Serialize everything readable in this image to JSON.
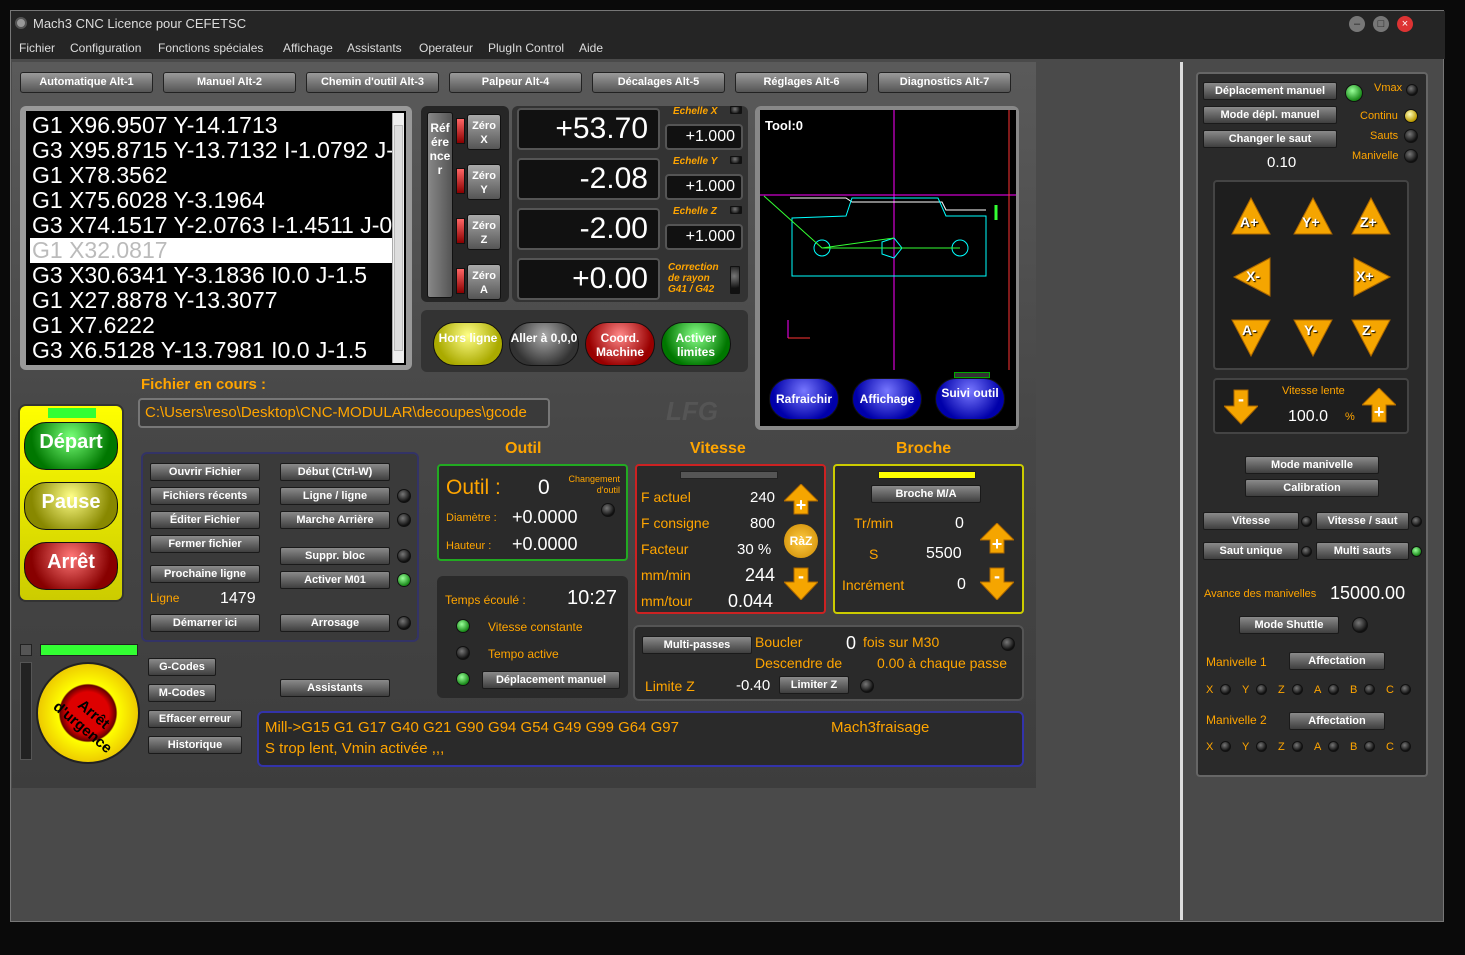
{
  "window": {
    "title": "Mach3 CNC  Licence pour CEFETSC"
  },
  "menu": [
    "Fichier",
    "Configuration",
    "Fonctions spéciales",
    "Affichage",
    "Assistants",
    "Operateur",
    "PlugIn Control",
    "Aide"
  ],
  "tabs": [
    "Automatique Alt-1",
    "Manuel Alt-2",
    "Chemin d'outil Alt-3",
    "Palpeur Alt-4",
    "Décalages Alt-5",
    "Réglages Alt-6",
    "Diagnostics Alt-7"
  ],
  "gcode": {
    "lines": [
      "G1 X96.9507 Y-14.1713",
      "G3 X95.8715 Y-13.7132 I-1.0792 J-",
      "G1 X78.3562",
      "G1 X75.6028 Y-3.1964",
      "G3 X74.1517 Y-2.0763 I-1.4511 J-0",
      "G1 X32.0817",
      "G3 X30.6341 Y-3.1836 I0.0 J-1.5",
      "G1 X27.8878 Y-13.3077",
      "G1 X7.6222",
      "G3 X6.5128 Y-13.7981 I0.0 J-1.5"
    ],
    "current_index": 5
  },
  "referencer": "Référencer",
  "zero_buttons": [
    "Zéro X",
    "Zéro Y",
    "Zéro Z",
    "Zéro A"
  ],
  "dro": {
    "x": "+53.70",
    "y": "-2.08",
    "z": "-2.00",
    "a": "+0.00"
  },
  "scales": {
    "x_label": "Echelle X",
    "y_label": "Echelle Y",
    "z_label": "Echelle Z",
    "x": "+1.000",
    "y": "+1.000",
    "z": "+1.000",
    "radius_label": "Correction de rayon G41 / G42"
  },
  "pills": {
    "offline": "Hors ligne",
    "goto": "Aller à 0,0,0",
    "machine": "Coord. Machine",
    "limits": "Activer limites"
  },
  "toolpath": {
    "label": "Tool:0",
    "refresh": "Rafraichir",
    "display": "Affichage",
    "follow": "Suivi outil"
  },
  "file": {
    "label": "Fichier en cours :",
    "path": "C:\\Users\\reso\\Desktop\\CNC-MODULAR\\decoupes\\gcode"
  },
  "cycle": {
    "start": "Départ",
    "pause": "Pause",
    "stop": "Arrêt",
    "estop": "Arrêt d'urgence"
  },
  "file_buttons": {
    "open": "Ouvrir Fichier",
    "recent": "Fichiers récents",
    "edit": "Éditer Fichier",
    "close": "Fermer fichier",
    "next_line": "Prochaine ligne",
    "line_label": "Ligne",
    "line_value": "1479",
    "start_here": "Démarrer ici",
    "begin": "Début (Ctrl-W)",
    "line_by_line": "Ligne / ligne",
    "reverse": "Marche Arrière",
    "block_delete": "Suppr. bloc",
    "m01": "Activer M01",
    "coolant": "Arrosage"
  },
  "left_buttons": {
    "gcodes": "G-Codes",
    "mcodes": "M-Codes",
    "reset": "Effacer erreur",
    "history": "Historique",
    "wizards": "Assistants"
  },
  "tool": {
    "title": "Outil",
    "label": "Outil :",
    "value": "0",
    "change": "Changement d'outil",
    "diam_label": "Diamètre :",
    "diam": "+0.0000",
    "height_label": "Hauteur :",
    "height": "+0.0000"
  },
  "time": {
    "label": "Temps écoulé :",
    "value": "10:27",
    "cv": "Vitesse constante",
    "dwell": "Tempo active",
    "jog": "Déplacement manuel"
  },
  "feed": {
    "title": "Vitesse",
    "actual_label": "F actuel",
    "actual": "240",
    "set_label": "F consigne",
    "set": "800",
    "factor_label": "Facteur",
    "factor": "30 %",
    "mmmin_label": "mm/min",
    "mmmin": "244",
    "mmrev_label": "mm/tour",
    "mmrev": "0.044",
    "raz": "RàZ"
  },
  "spindle": {
    "title": "Broche",
    "toggle": "Broche M/A",
    "rpm_label": "Tr/min",
    "rpm": "0",
    "s_label": "S",
    "s": "5500",
    "inc_label": "Incrément",
    "inc": "0"
  },
  "multipass": {
    "button": "Multi-passes",
    "loop_label": "Boucler",
    "loop_val": "0",
    "loop_suffix": "fois sur M30",
    "down_label": "Descendre de",
    "down_val": "0.00 à chaque passe",
    "limitz_label": "Limite Z",
    "limitz_val": "-0.40",
    "limitz_btn": "Limiter Z"
  },
  "status": {
    "modal": "Mill->G15  G1 G17 G40 G21 G90 G94 G54 G49 G99 G64 G97",
    "profile": "Mach3fraisage",
    "message": "S trop lent, Vmin activée ,,,"
  },
  "jog": {
    "manual": "Déplacement manuel",
    "mode": "Mode dépl. manuel",
    "step": "Changer le saut",
    "step_value": "0.10",
    "vmax": "Vmax",
    "continu": "Continu",
    "sauts": "Sauts",
    "manivelle": "Manivelle",
    "arrows": [
      "A+",
      "Y+",
      "Z+",
      "X-",
      "X+",
      "A-",
      "Y-",
      "Z-"
    ],
    "slow_label": "Vitesse lente",
    "slow_value": "100.0",
    "pct": "%",
    "mpg_mode": "Mode manivelle",
    "calibration": "Calibration",
    "speed": "Vitesse",
    "speed_step": "Vitesse / saut",
    "single": "Saut unique",
    "multi": "Multi sauts",
    "mpg_feed_label": "Avance des manivelles",
    "mpg_feed": "15000.00",
    "shuttle": "Mode Shuttle",
    "mpg1": "Manivelle 1",
    "mpg2": "Manivelle 2",
    "assign": "Affectation",
    "axes": [
      "X",
      "Y",
      "Z",
      "A",
      "B",
      "C"
    ]
  }
}
